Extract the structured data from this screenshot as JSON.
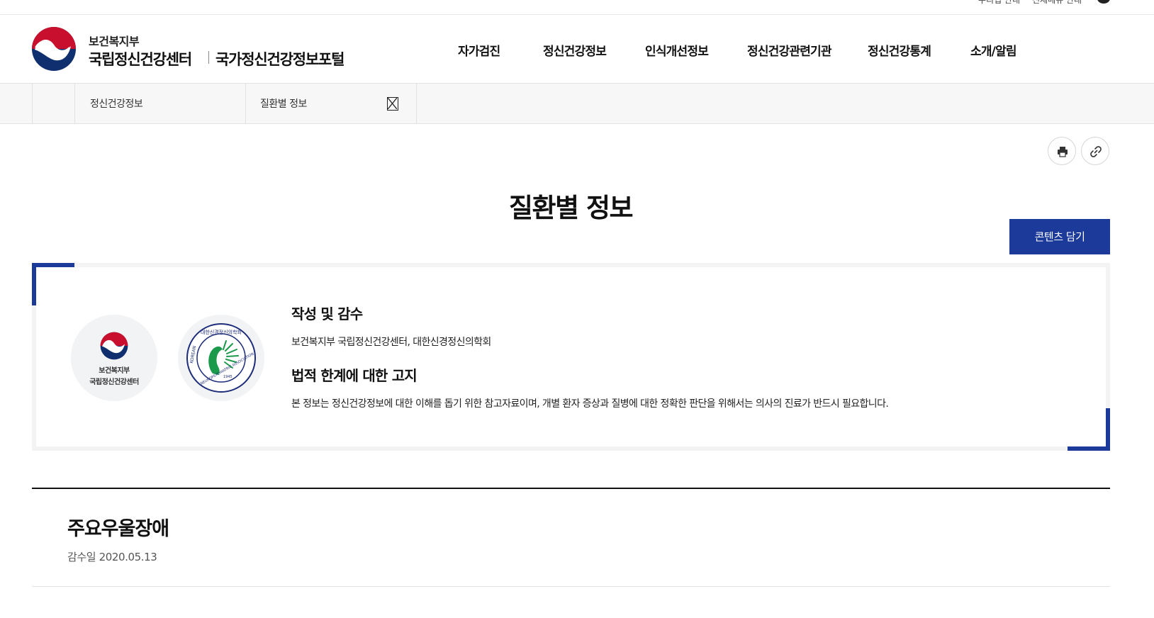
{
  "utility": {
    "link1": "누리집 안내",
    "link2": "전체메뉴 안내"
  },
  "header": {
    "ministry": "보건복지부",
    "center_name": "국립정신건강센터",
    "portal_name": "국가정신건강정보포털"
  },
  "gnb": [
    "자가검진",
    "정신건강정보",
    "인식개선정보",
    "정신건강관련기관",
    "정신건강통계",
    "소개/알림"
  ],
  "location": {
    "depth1": "정신건강정보",
    "depth2": "질환별 정보"
  },
  "tools": {
    "print_icon": "print-icon",
    "link_icon": "link-icon"
  },
  "page_title": "질환별 정보",
  "save_button": "콘텐츠 담기",
  "info": {
    "logo1_line1": "보건복지부",
    "logo1_line2": "국립정신건강센터",
    "logo2_text_top": "대한신경정신의학회",
    "logo2_text_left": "KOREAN",
    "logo2_text_right": "NEUROPSYCHIATRIC ASSOCIATION",
    "logo2_year": "1945",
    "author_heading": "작성 및 감수",
    "author_text": "보건복지부 국립정신건강센터, 대한신경정신의학회",
    "notice_heading": "법적 한계에 대한 고지",
    "notice_text": "본 정보는 정신건강정보에 대한 이해를 돕기 위한 참고자료이며, 개별 환자 증상과 질병에 대한 정확한 판단을 위해서는 의사의 진료가 반드시 필요합니다."
  },
  "disease": {
    "title": "주요우울장애",
    "review_date": "감수일 2020.05.13"
  },
  "colors": {
    "brand_blue": "#1b3a9a",
    "emblem_red": "#c8102e",
    "emblem_blue": "#0f2f6e",
    "association_green": "#1a9a4a"
  }
}
